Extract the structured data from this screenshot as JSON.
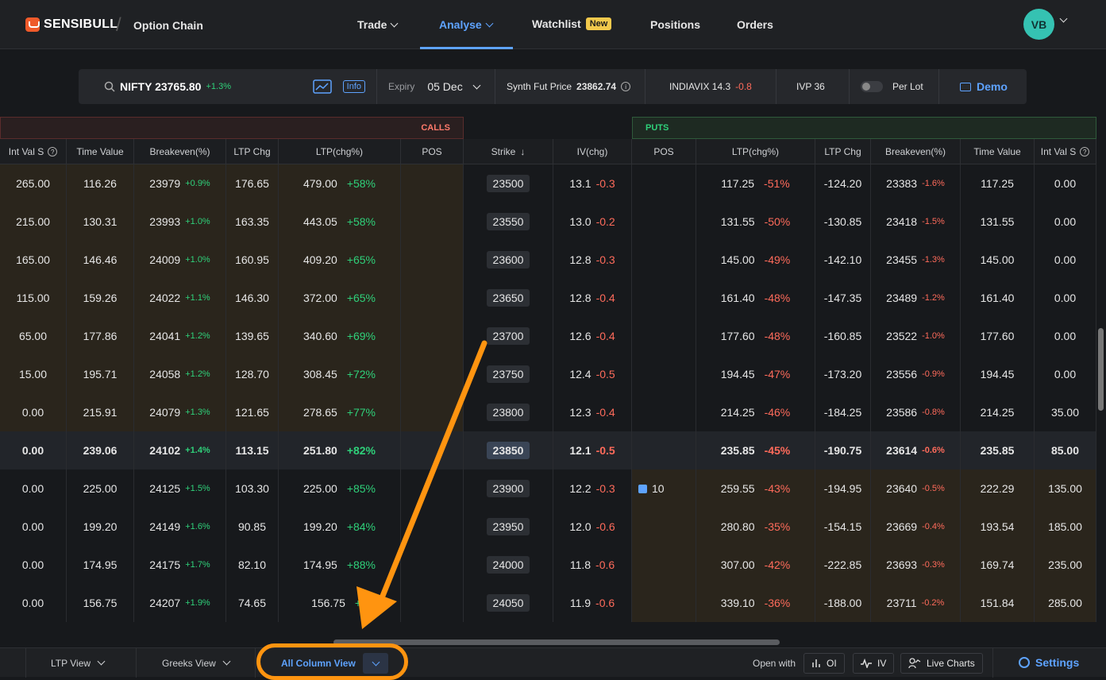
{
  "nav": {
    "brand": "SENSIBULL",
    "page_title": "Option Chain",
    "items": [
      {
        "label": "Trade"
      },
      {
        "label": "Analyse"
      },
      {
        "label": "Watchlist",
        "badge": "New"
      },
      {
        "label": "Positions"
      },
      {
        "label": "Orders"
      }
    ],
    "avatar_initials": "VB"
  },
  "infobar": {
    "symbol": "NIFTY 23765.80",
    "symbol_change": "+1.3%",
    "info_label": "Info",
    "expiry_label": "Expiry",
    "expiry_value": "05 Dec",
    "synth_label": "Synth Fut Price",
    "synth_value": "23862.74",
    "vix_label": "INDIAVIX 14.3",
    "vix_change": "-0.8",
    "ivp": "IVP 36",
    "per_lot_label": "Per Lot",
    "demo_label": "Demo"
  },
  "sections": {
    "calls": "CALLS",
    "puts": "PUTS"
  },
  "columns": {
    "calls": [
      "Int Val S",
      "Time Value",
      "Breakeven(%)",
      "LTP Chg",
      "LTP(chg%)",
      "POS"
    ],
    "middle": [
      "Strike",
      "IV(chg)"
    ],
    "puts": [
      "POS",
      "LTP(chg%)",
      "LTP Chg",
      "Breakeven(%)",
      "Time Value",
      "Int Val S"
    ]
  },
  "rows": [
    {
      "c_int": "265.00",
      "c_tv": "116.26",
      "c_be": "23979",
      "c_bep": "+0.9%",
      "c_ltpchg": "176.65",
      "c_ltp": "479.00",
      "c_ltpp": "+58%",
      "c_pos": "",
      "strike": "23500",
      "iv": "13.1",
      "ivc": "-0.3",
      "p_pos": "",
      "p_ltp": "117.25",
      "p_ltpp": "-51%",
      "p_ltpchg": "-124.20",
      "p_be": "23383",
      "p_bep": "-1.6%",
      "p_tv": "117.25",
      "p_int": "0.00"
    },
    {
      "c_int": "215.00",
      "c_tv": "130.31",
      "c_be": "23993",
      "c_bep": "+1.0%",
      "c_ltpchg": "163.35",
      "c_ltp": "443.05",
      "c_ltpp": "+58%",
      "c_pos": "",
      "strike": "23550",
      "iv": "13.0",
      "ivc": "-0.2",
      "p_pos": "",
      "p_ltp": "131.55",
      "p_ltpp": "-50%",
      "p_ltpchg": "-130.85",
      "p_be": "23418",
      "p_bep": "-1.5%",
      "p_tv": "131.55",
      "p_int": "0.00"
    },
    {
      "c_int": "165.00",
      "c_tv": "146.46",
      "c_be": "24009",
      "c_bep": "+1.0%",
      "c_ltpchg": "160.95",
      "c_ltp": "409.20",
      "c_ltpp": "+65%",
      "c_pos": "",
      "strike": "23600",
      "iv": "12.8",
      "ivc": "-0.3",
      "p_pos": "",
      "p_ltp": "145.00",
      "p_ltpp": "-49%",
      "p_ltpchg": "-142.10",
      "p_be": "23455",
      "p_bep": "-1.3%",
      "p_tv": "145.00",
      "p_int": "0.00"
    },
    {
      "c_int": "115.00",
      "c_tv": "159.26",
      "c_be": "24022",
      "c_bep": "+1.1%",
      "c_ltpchg": "146.30",
      "c_ltp": "372.00",
      "c_ltpp": "+65%",
      "c_pos": "",
      "strike": "23650",
      "iv": "12.8",
      "ivc": "-0.4",
      "p_pos": "",
      "p_ltp": "161.40",
      "p_ltpp": "-48%",
      "p_ltpchg": "-147.35",
      "p_be": "23489",
      "p_bep": "-1.2%",
      "p_tv": "161.40",
      "p_int": "0.00"
    },
    {
      "c_int": "65.00",
      "c_tv": "177.86",
      "c_be": "24041",
      "c_bep": "+1.2%",
      "c_ltpchg": "139.65",
      "c_ltp": "340.60",
      "c_ltpp": "+69%",
      "c_pos": "",
      "strike": "23700",
      "iv": "12.6",
      "ivc": "-0.4",
      "p_pos": "",
      "p_ltp": "177.60",
      "p_ltpp": "-48%",
      "p_ltpchg": "-160.85",
      "p_be": "23522",
      "p_bep": "-1.0%",
      "p_tv": "177.60",
      "p_int": "0.00"
    },
    {
      "c_int": "15.00",
      "c_tv": "195.71",
      "c_be": "24058",
      "c_bep": "+1.2%",
      "c_ltpchg": "128.70",
      "c_ltp": "308.45",
      "c_ltpp": "+72%",
      "c_pos": "",
      "strike": "23750",
      "iv": "12.4",
      "ivc": "-0.5",
      "p_pos": "",
      "p_ltp": "194.45",
      "p_ltpp": "-47%",
      "p_ltpchg": "-173.20",
      "p_be": "23556",
      "p_bep": "-0.9%",
      "p_tv": "194.45",
      "p_int": "0.00"
    },
    {
      "c_int": "0.00",
      "c_tv": "215.91",
      "c_be": "24079",
      "c_bep": "+1.3%",
      "c_ltpchg": "121.65",
      "c_ltp": "278.65",
      "c_ltpp": "+77%",
      "c_pos": "",
      "strike": "23800",
      "iv": "12.3",
      "ivc": "-0.4",
      "p_pos": "",
      "p_ltp": "214.25",
      "p_ltpp": "-46%",
      "p_ltpchg": "-184.25",
      "p_be": "23586",
      "p_bep": "-0.8%",
      "p_tv": "214.25",
      "p_int": "35.00"
    },
    {
      "c_int": "0.00",
      "c_tv": "239.06",
      "c_be": "24102",
      "c_bep": "+1.4%",
      "c_ltpchg": "113.15",
      "c_ltp": "251.80",
      "c_ltpp": "+82%",
      "c_pos": "",
      "strike": "23850",
      "iv": "12.1",
      "ivc": "-0.5",
      "p_pos": "",
      "p_ltp": "235.85",
      "p_ltpp": "-45%",
      "p_ltpchg": "-190.75",
      "p_be": "23614",
      "p_bep": "-0.6%",
      "p_tv": "235.85",
      "p_int": "85.00"
    },
    {
      "c_int": "0.00",
      "c_tv": "225.00",
      "c_be": "24125",
      "c_bep": "+1.5%",
      "c_ltpchg": "103.30",
      "c_ltp": "225.00",
      "c_ltpp": "+85%",
      "c_pos": "",
      "strike": "23900",
      "iv": "12.2",
      "ivc": "-0.3",
      "p_pos": "10",
      "p_ltp": "259.55",
      "p_ltpp": "-43%",
      "p_ltpchg": "-194.95",
      "p_be": "23640",
      "p_bep": "-0.5%",
      "p_tv": "222.29",
      "p_int": "135.00"
    },
    {
      "c_int": "0.00",
      "c_tv": "199.20",
      "c_be": "24149",
      "c_bep": "+1.6%",
      "c_ltpchg": "90.85",
      "c_ltp": "199.20",
      "c_ltpp": "+84%",
      "c_pos": "",
      "strike": "23950",
      "iv": "12.0",
      "ivc": "-0.6",
      "p_pos": "",
      "p_ltp": "280.80",
      "p_ltpp": "-35%",
      "p_ltpchg": "-154.15",
      "p_be": "23669",
      "p_bep": "-0.4%",
      "p_tv": "193.54",
      "p_int": "185.00"
    },
    {
      "c_int": "0.00",
      "c_tv": "174.95",
      "c_be": "24175",
      "c_bep": "+1.7%",
      "c_ltpchg": "82.10",
      "c_ltp": "174.95",
      "c_ltpp": "+88%",
      "c_pos": "",
      "strike": "24000",
      "iv": "11.8",
      "ivc": "-0.6",
      "p_pos": "",
      "p_ltp": "307.00",
      "p_ltpp": "-42%",
      "p_ltpchg": "-222.85",
      "p_be": "23693",
      "p_bep": "-0.3%",
      "p_tv": "169.74",
      "p_int": "235.00"
    },
    {
      "c_int": "0.00",
      "c_tv": "156.75",
      "c_be": "24207",
      "c_bep": "+1.9%",
      "c_ltpchg": "74.65",
      "c_ltp": "156.75",
      "c_ltpp": "+9",
      "c_pos": "",
      "strike": "24050",
      "iv": "11.9",
      "ivc": "-0.6",
      "p_pos": "",
      "p_ltp": "339.10",
      "p_ltpp": "-36%",
      "p_ltpchg": "-188.00",
      "p_be": "23711",
      "p_bep": "-0.2%",
      "p_tv": "151.84",
      "p_int": "285.00"
    }
  ],
  "atm_strike": "23850",
  "bottom": {
    "ltp_view": "LTP View",
    "greeks_view": "Greeks View",
    "all_column_view": "All Column View",
    "open_with": "Open with",
    "oi": "OI",
    "iv": "IV",
    "live_charts": "Live Charts",
    "settings": "Settings"
  },
  "colors": {
    "accent": "#5ea3ff",
    "green": "#2fd17a",
    "red": "#ff6b5b",
    "annotation": "#ff9410"
  }
}
